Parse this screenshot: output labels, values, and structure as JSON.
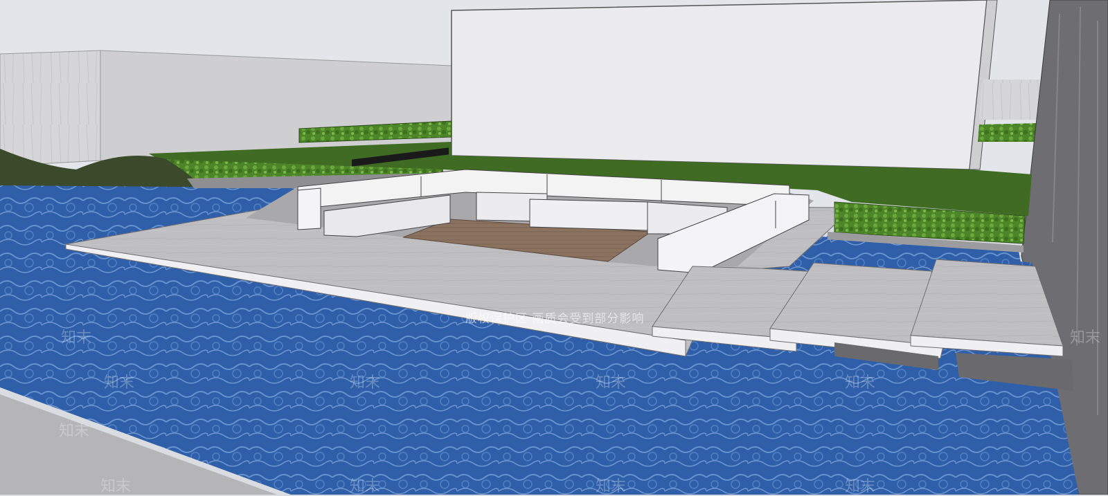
{
  "scene": {
    "watermark_brand": "知末",
    "watermark_notice": "版权保护区  画质会受到部分影响"
  },
  "palette": {
    "sky": "#e2e5ea",
    "wall_white": "#ebebee",
    "wall_marble": "#d4d4d6",
    "lawn": "#3f6b22",
    "hedge": "#4f8a2a",
    "water": "#2f5fa8",
    "water_light": "#6a9ad6",
    "deck_stone": "#bdbdbf",
    "sofa": "#f3f3f3",
    "wood": "#8c7460",
    "pillar": "#6e6e72"
  }
}
